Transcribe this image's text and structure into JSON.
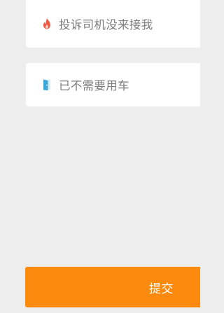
{
  "reasons": {
    "items": [
      {
        "label": "投诉司机没来接我",
        "icon": "flame-icon",
        "icon_color": "#f05a45"
      },
      {
        "label": "已不需要用车",
        "icon": "door-icon",
        "icon_color": "#3aa7d6"
      }
    ]
  },
  "footer": {
    "submit_label": "提交",
    "submit_color": "#fb8a0e"
  },
  "background_color": "#ededed"
}
